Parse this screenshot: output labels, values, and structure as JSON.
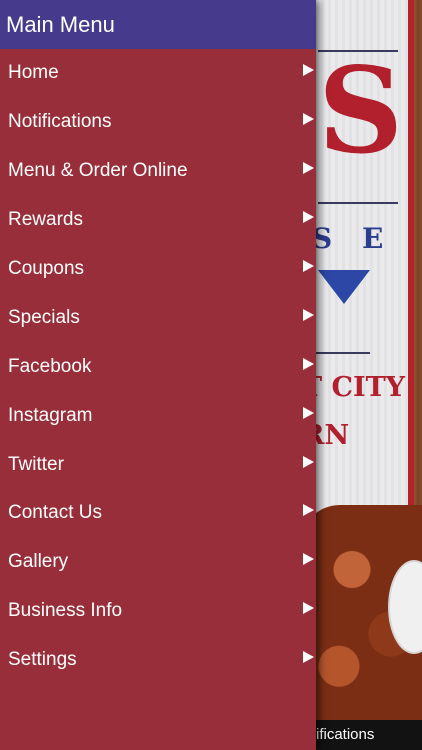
{
  "drawer": {
    "title": "Main Menu",
    "items": [
      {
        "label": "Home"
      },
      {
        "label": "Notifications"
      },
      {
        "label": "Menu & Order Online"
      },
      {
        "label": "Rewards"
      },
      {
        "label": "Coupons"
      },
      {
        "label": "Specials"
      },
      {
        "label": "Facebook"
      },
      {
        "label": "Instagram"
      },
      {
        "label": "Twitter"
      },
      {
        "label": "Contact Us"
      },
      {
        "label": "Gallery"
      },
      {
        "label": "Business Info"
      },
      {
        "label": "Settings"
      }
    ],
    "colors": {
      "header": "#453a8c",
      "background": "#982e3a",
      "text": "#ffffff"
    }
  },
  "background": {
    "sign_fragment_1": "S",
    "sign_fragment_2": "S E",
    "sign_fragment_3": "T CITY",
    "sign_fragment_4": "RN",
    "bottom_bar_label": "ifications"
  }
}
